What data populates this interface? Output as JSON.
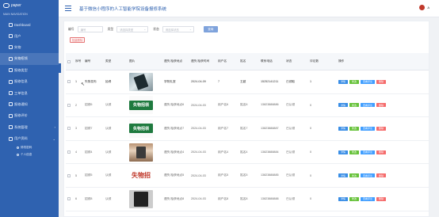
{
  "app": {
    "logo_text": "paper",
    "title": "基于微信小程序的人工智能学院设备报修系统",
    "user_name": "A"
  },
  "sidebar": {
    "caption": "MAIN NAVIGATION",
    "items": [
      {
        "label": "Dashboard"
      },
      {
        "label": "用户"
      },
      {
        "label": "失物"
      },
      {
        "label": "失物招领",
        "active": true
      },
      {
        "label": "报修类型"
      },
      {
        "label": "报修信息"
      },
      {
        "label": "工单信息"
      },
      {
        "label": "报修通知"
      },
      {
        "label": "报修评价"
      },
      {
        "label": "系统管理",
        "arrow": "›"
      },
      {
        "label": "用户资料",
        "arrow": "⌄"
      }
    ],
    "sub_items": [
      {
        "label": "修改密码"
      },
      {
        "label": "个人信息"
      }
    ]
  },
  "filters": {
    "code_label": "编号",
    "code_placeholder": "编号",
    "type_label": "类型",
    "type_placeholder": "请选择类型",
    "status_label": "状态",
    "status_placeholder": "请选择状态",
    "search_label": "查询",
    "delete_label": "批量删除"
  },
  "table": {
    "headers": [
      "序号",
      "编号",
      "类型",
      "图片",
      "遗失/拾获地点",
      "遗失/拾获时间",
      "用户名",
      "姓名",
      "联系电话",
      "状态",
      "评论数",
      "操作"
    ],
    "rows": [
      {
        "no": "1",
        "code": "失物发布",
        "type": "拾得",
        "img": "phone",
        "place": "学院礼堂",
        "date": "2024-04-09",
        "user": "7",
        "name": "王超",
        "phone": "15252141211",
        "status": "已领取",
        "reviews": "1"
      },
      {
        "no": "2",
        "code": "招领6",
        "type": "认领",
        "img": "sign",
        "place": "遗失/拾获地点6",
        "date": "2024-04-03",
        "user": "用户名6",
        "name": "姓名6",
        "phone": "13823888886",
        "status": "已认领",
        "reviews": "0"
      },
      {
        "no": "3",
        "code": "招领7",
        "type": "认领",
        "img": "sign",
        "place": "遗失/拾获地点7",
        "date": "2024-04-03",
        "user": "用户名7",
        "name": "姓名7",
        "phone": "13823888887",
        "status": "已认领",
        "reviews": "0"
      },
      {
        "no": "4",
        "code": "招领4",
        "type": "认领",
        "img": "device",
        "place": "遗失/拾获地点4",
        "date": "2024-04-03",
        "user": "用户名4",
        "name": "姓名4",
        "phone": "13823888884",
        "status": "已认领",
        "reviews": "0"
      },
      {
        "no": "5",
        "code": "招领5",
        "type": "认领",
        "img": "redsign",
        "place": "遗失/拾获地点5",
        "date": "2024-04-03",
        "user": "用户名5",
        "name": "姓名5",
        "phone": "13823888885",
        "status": "已认领",
        "reviews": "0"
      },
      {
        "no": "6",
        "code": "招领8",
        "type": "认领",
        "img": "tablet",
        "place": "遗失/拾获地点8",
        "date": "2024-04-03",
        "user": "用户名8",
        "name": "姓名8",
        "phone": "13823888888",
        "status": "已认领",
        "reviews": "0"
      }
    ],
    "sign_text": "失物招领",
    "redsign_text": "失物招"
  },
  "ops": {
    "a": "详情",
    "b": "修改",
    "c": "查看评论",
    "d": "删除"
  }
}
